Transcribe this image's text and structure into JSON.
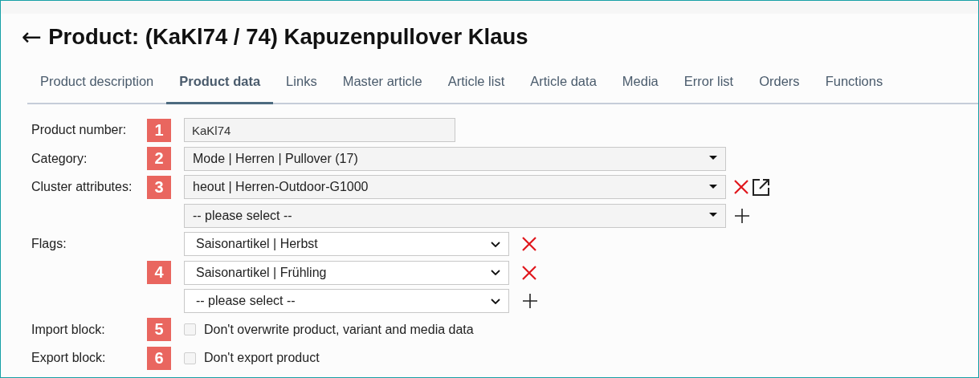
{
  "header": {
    "back_label": "←",
    "title": "Product: (KaKl74 / 74) Kapuzenpullover Klaus"
  },
  "tabs": [
    {
      "label": "Product description",
      "selected": false
    },
    {
      "label": "Product data",
      "selected": true
    },
    {
      "label": "Links",
      "selected": false
    },
    {
      "label": "Master article",
      "selected": false
    },
    {
      "label": "Article list",
      "selected": false
    },
    {
      "label": "Article data",
      "selected": false
    },
    {
      "label": "Media",
      "selected": false
    },
    {
      "label": "Error list",
      "selected": false
    },
    {
      "label": "Orders",
      "selected": false
    },
    {
      "label": "Functions",
      "selected": false
    }
  ],
  "form": [
    {
      "label": "Product number:",
      "badge": "1",
      "kind": "input",
      "value": "KaKl74"
    },
    {
      "label": "Category:",
      "badge": "2",
      "kind": "combo",
      "value": "Mode | Herren | Pullover (17)"
    },
    {
      "label": "Cluster attributes:",
      "badge": "3",
      "kind": "combo",
      "value": "heout | Herren-Outdoor-G1000",
      "removable": true,
      "openable": true
    },
    {
      "kind": "combo",
      "value": "-- please select --",
      "addable": true
    },
    {
      "label": "Flags:",
      "kind": "select",
      "value": "Saisonartikel | Herbst",
      "removable": true
    },
    {
      "badge": "4",
      "kind": "select",
      "value": "Saisonartikel | Frühling",
      "removable": true
    },
    {
      "kind": "select",
      "value": "-- please select --",
      "addable": true
    },
    {
      "label": "Import block:",
      "badge": "5",
      "kind": "checkbox",
      "text": "Don't overwrite product, variant and media data",
      "checked": false
    },
    {
      "label": "Export block:",
      "badge": "6",
      "kind": "checkbox",
      "text": "Don't export product",
      "checked": false
    }
  ]
}
